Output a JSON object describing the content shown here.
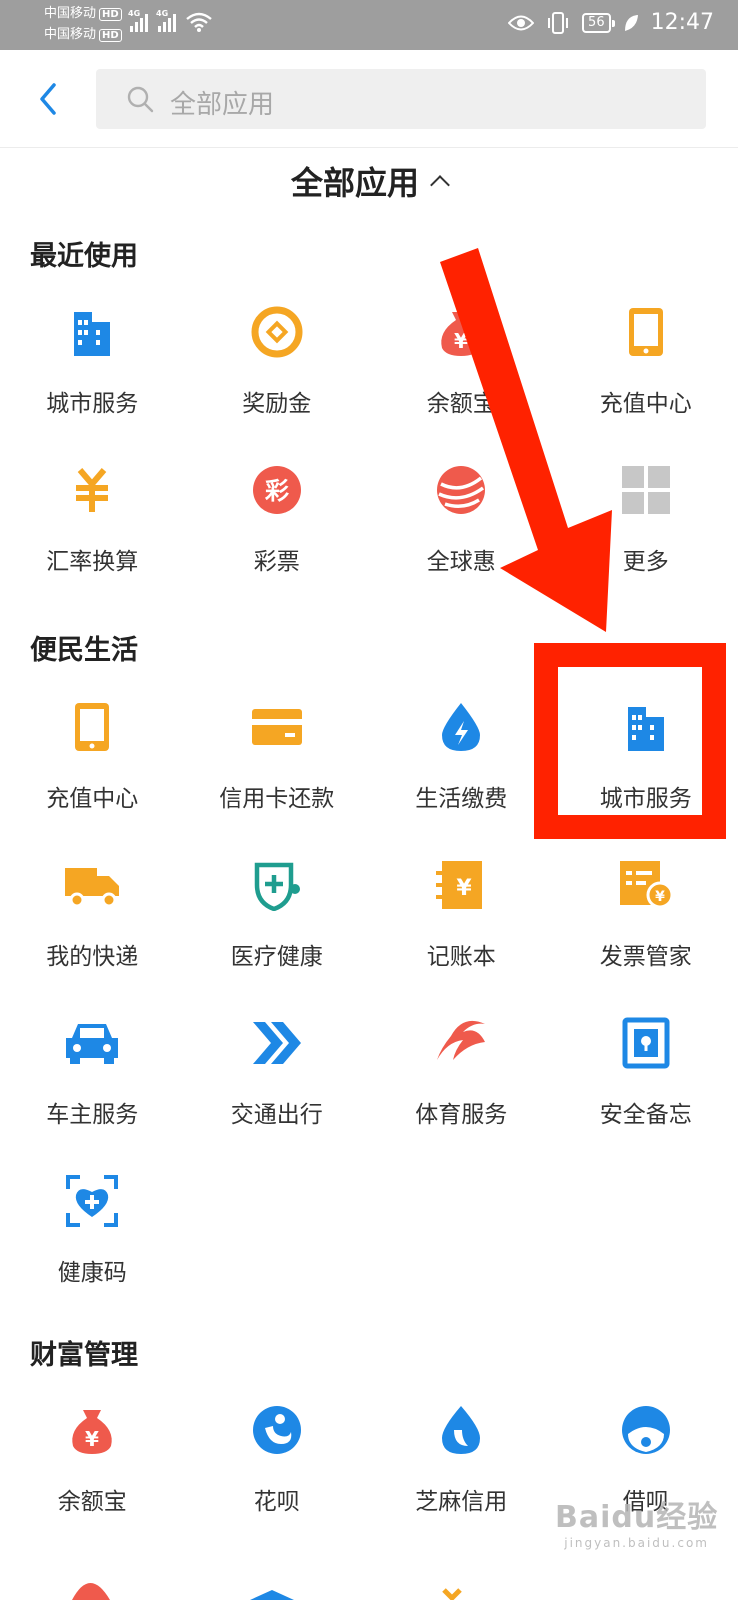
{
  "status_bar": {
    "carrier_1": "中国移动",
    "carrier_2": "中国移动",
    "hd": "HD",
    "net": "4G",
    "battery": "56",
    "time": "12:47"
  },
  "search": {
    "placeholder": "全部应用"
  },
  "page_title": "全部应用",
  "sections": {
    "recent": {
      "title": "最近使用",
      "items": [
        {
          "label": "城市服务",
          "icon": "city-building-icon"
        },
        {
          "label": "奖励金",
          "icon": "reward-coin-icon"
        },
        {
          "label": "余额宝",
          "icon": "money-bag-icon"
        },
        {
          "label": "充值中心",
          "icon": "phone-recharge-icon"
        },
        {
          "label": "汇率换算",
          "icon": "exchange-rate-icon"
        },
        {
          "label": "彩票",
          "icon": "lottery-icon"
        },
        {
          "label": "全球惠",
          "icon": "globe-deal-icon"
        },
        {
          "label": "更多",
          "icon": "more-grid-icon"
        }
      ]
    },
    "life": {
      "title": "便民生活",
      "items": [
        {
          "label": "充值中心",
          "icon": "phone-recharge-icon"
        },
        {
          "label": "信用卡还款",
          "icon": "credit-card-icon"
        },
        {
          "label": "生活缴费",
          "icon": "utility-bill-icon"
        },
        {
          "label": "城市服务",
          "icon": "city-building-icon"
        },
        {
          "label": "我的快递",
          "icon": "delivery-truck-icon"
        },
        {
          "label": "医疗健康",
          "icon": "medical-health-icon"
        },
        {
          "label": "记账本",
          "icon": "ledger-icon"
        },
        {
          "label": "发票管家",
          "icon": "invoice-icon"
        },
        {
          "label": "车主服务",
          "icon": "car-icon"
        },
        {
          "label": "交通出行",
          "icon": "transport-arrows-icon"
        },
        {
          "label": "体育服务",
          "icon": "sports-icon"
        },
        {
          "label": "安全备忘",
          "icon": "safe-icon"
        },
        {
          "label": "健康码",
          "icon": "health-code-icon"
        }
      ]
    },
    "wealth": {
      "title": "财富管理",
      "items": [
        {
          "label": "余额宝",
          "icon": "money-bag-icon"
        },
        {
          "label": "花呗",
          "icon": "huabei-icon"
        },
        {
          "label": "芝麻信用",
          "icon": "sesame-credit-icon"
        },
        {
          "label": "借呗",
          "icon": "jiebei-icon"
        }
      ]
    }
  },
  "watermark": {
    "text": "Baidu经验",
    "sub": "jingyan.baidu.com"
  },
  "colors": {
    "blue": "#1e88e5",
    "orange": "#f5a623",
    "red": "#ef5a4c",
    "teal": "#1f9d8f",
    "highlight": "#ff2200"
  }
}
